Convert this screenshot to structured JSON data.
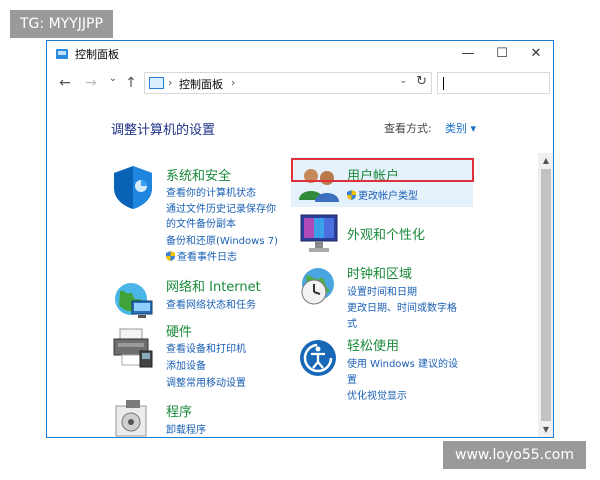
{
  "watermarks": {
    "top_left": "TG: MYYJJPP",
    "bottom_right": "www.loyo55.com"
  },
  "window": {
    "title": "控制面板",
    "controls": {
      "minimize": "—",
      "maximize": "☐",
      "close": "✕"
    }
  },
  "nav": {
    "back": "←",
    "forward": "→",
    "dropdown": "⌄",
    "up": "↑",
    "breadcrumb_sep": "›",
    "breadcrumb": "控制面板",
    "addr_dropdown": "⌄",
    "refresh": "↻",
    "search_value": ""
  },
  "page": {
    "title": "调整计算机的设置",
    "view_by_label": "查看方式:",
    "view_by_value": "类别 ▾"
  },
  "categories_left": [
    {
      "title": "系统和安全",
      "links": [
        "查看你的计算机状态",
        "通过文件历史记录保存你",
        "的文件备份副本",
        "备份和还原(Windows 7)",
        "查看事件日志"
      ]
    },
    {
      "title": "网络和 Internet",
      "links": [
        "查看网络状态和任务"
      ]
    },
    {
      "title": "硬件",
      "links": [
        "查看设备和打印机",
        "添加设备",
        "调整常用移动设置"
      ]
    },
    {
      "title": "程序",
      "links": [
        "卸载程序"
      ]
    }
  ],
  "categories_right": [
    {
      "title": "用户帐户",
      "links": [
        "更改帐户类型"
      ]
    },
    {
      "title": "外观和个性化",
      "links": []
    },
    {
      "title": "时钟和区域",
      "links": [
        "设置时间和日期",
        "更改日期、时间或数字格",
        "式"
      ]
    },
    {
      "title": "轻松使用",
      "links": [
        "使用 Windows 建议的设",
        "置",
        "优化视觉显示"
      ]
    }
  ],
  "scrollbar": {
    "up": "▲",
    "down": "▼"
  },
  "colors": {
    "accent": "#1a7fd4",
    "category_green": "#1a8a3a",
    "link_blue": "#1a5fb4",
    "highlight_red": "#e0303a"
  }
}
